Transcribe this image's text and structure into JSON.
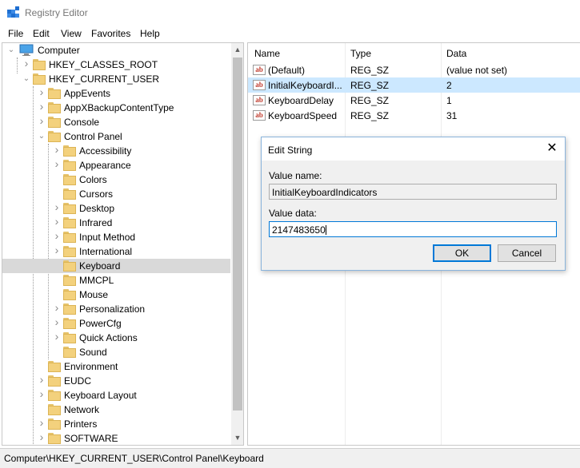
{
  "window": {
    "title": "Registry Editor",
    "icon": "registry-editor-icon"
  },
  "menu": [
    "File",
    "Edit",
    "View",
    "Favorites",
    "Help"
  ],
  "tree": {
    "root": "Computer",
    "items": [
      {
        "label": "HKEY_CLASSES_ROOT",
        "level": 1,
        "expander": "collapsed"
      },
      {
        "label": "HKEY_CURRENT_USER",
        "level": 1,
        "expander": "expanded"
      },
      {
        "label": "AppEvents",
        "level": 2,
        "expander": "collapsed"
      },
      {
        "label": "AppXBackupContentType",
        "level": 2,
        "expander": "collapsed"
      },
      {
        "label": "Console",
        "level": 2,
        "expander": "collapsed"
      },
      {
        "label": "Control Panel",
        "level": 2,
        "expander": "expanded"
      },
      {
        "label": "Accessibility",
        "level": 3,
        "expander": "collapsed"
      },
      {
        "label": "Appearance",
        "level": 3,
        "expander": "collapsed"
      },
      {
        "label": "Colors",
        "level": 3,
        "expander": "none"
      },
      {
        "label": "Cursors",
        "level": 3,
        "expander": "none"
      },
      {
        "label": "Desktop",
        "level": 3,
        "expander": "collapsed"
      },
      {
        "label": "Infrared",
        "level": 3,
        "expander": "collapsed"
      },
      {
        "label": "Input Method",
        "level": 3,
        "expander": "collapsed"
      },
      {
        "label": "International",
        "level": 3,
        "expander": "collapsed"
      },
      {
        "label": "Keyboard",
        "level": 3,
        "expander": "none",
        "selected": true
      },
      {
        "label": "MMCPL",
        "level": 3,
        "expander": "none"
      },
      {
        "label": "Mouse",
        "level": 3,
        "expander": "none"
      },
      {
        "label": "Personalization",
        "level": 3,
        "expander": "collapsed"
      },
      {
        "label": "PowerCfg",
        "level": 3,
        "expander": "collapsed"
      },
      {
        "label": "Quick Actions",
        "level": 3,
        "expander": "collapsed"
      },
      {
        "label": "Sound",
        "level": 3,
        "expander": "none"
      },
      {
        "label": "Environment",
        "level": 2,
        "expander": "none"
      },
      {
        "label": "EUDC",
        "level": 2,
        "expander": "collapsed"
      },
      {
        "label": "Keyboard Layout",
        "level": 2,
        "expander": "collapsed"
      },
      {
        "label": "Network",
        "level": 2,
        "expander": "none"
      },
      {
        "label": "Printers",
        "level": 2,
        "expander": "collapsed"
      },
      {
        "label": "SOFTWARE",
        "level": 2,
        "expander": "collapsed"
      }
    ]
  },
  "values_table": {
    "headers": {
      "name": "Name",
      "type": "Type",
      "data": "Data"
    },
    "rows": [
      {
        "name": "(Default)",
        "type": "REG_SZ",
        "data": "(value not set)"
      },
      {
        "name": "InitialKeyboardI...",
        "type": "REG_SZ",
        "data": "2",
        "selected": true
      },
      {
        "name": "KeyboardDelay",
        "type": "REG_SZ",
        "data": "1"
      },
      {
        "name": "KeyboardSpeed",
        "type": "REG_SZ",
        "data": "31"
      }
    ]
  },
  "dialog": {
    "title": "Edit String",
    "value_name_label": "Value name:",
    "value_name": "InitialKeyboardIndicators",
    "value_data_label": "Value data:",
    "value_data": "2147483650",
    "ok_label": "OK",
    "cancel_label": "Cancel"
  },
  "status_bar": {
    "path": "Computer\\HKEY_CURRENT_USER\\Control Panel\\Keyboard"
  },
  "colors": {
    "selection": "#cce8ff",
    "tree_selection": "#d9d9d9",
    "accent": "#0078d7",
    "folder": "#f3d17d"
  }
}
